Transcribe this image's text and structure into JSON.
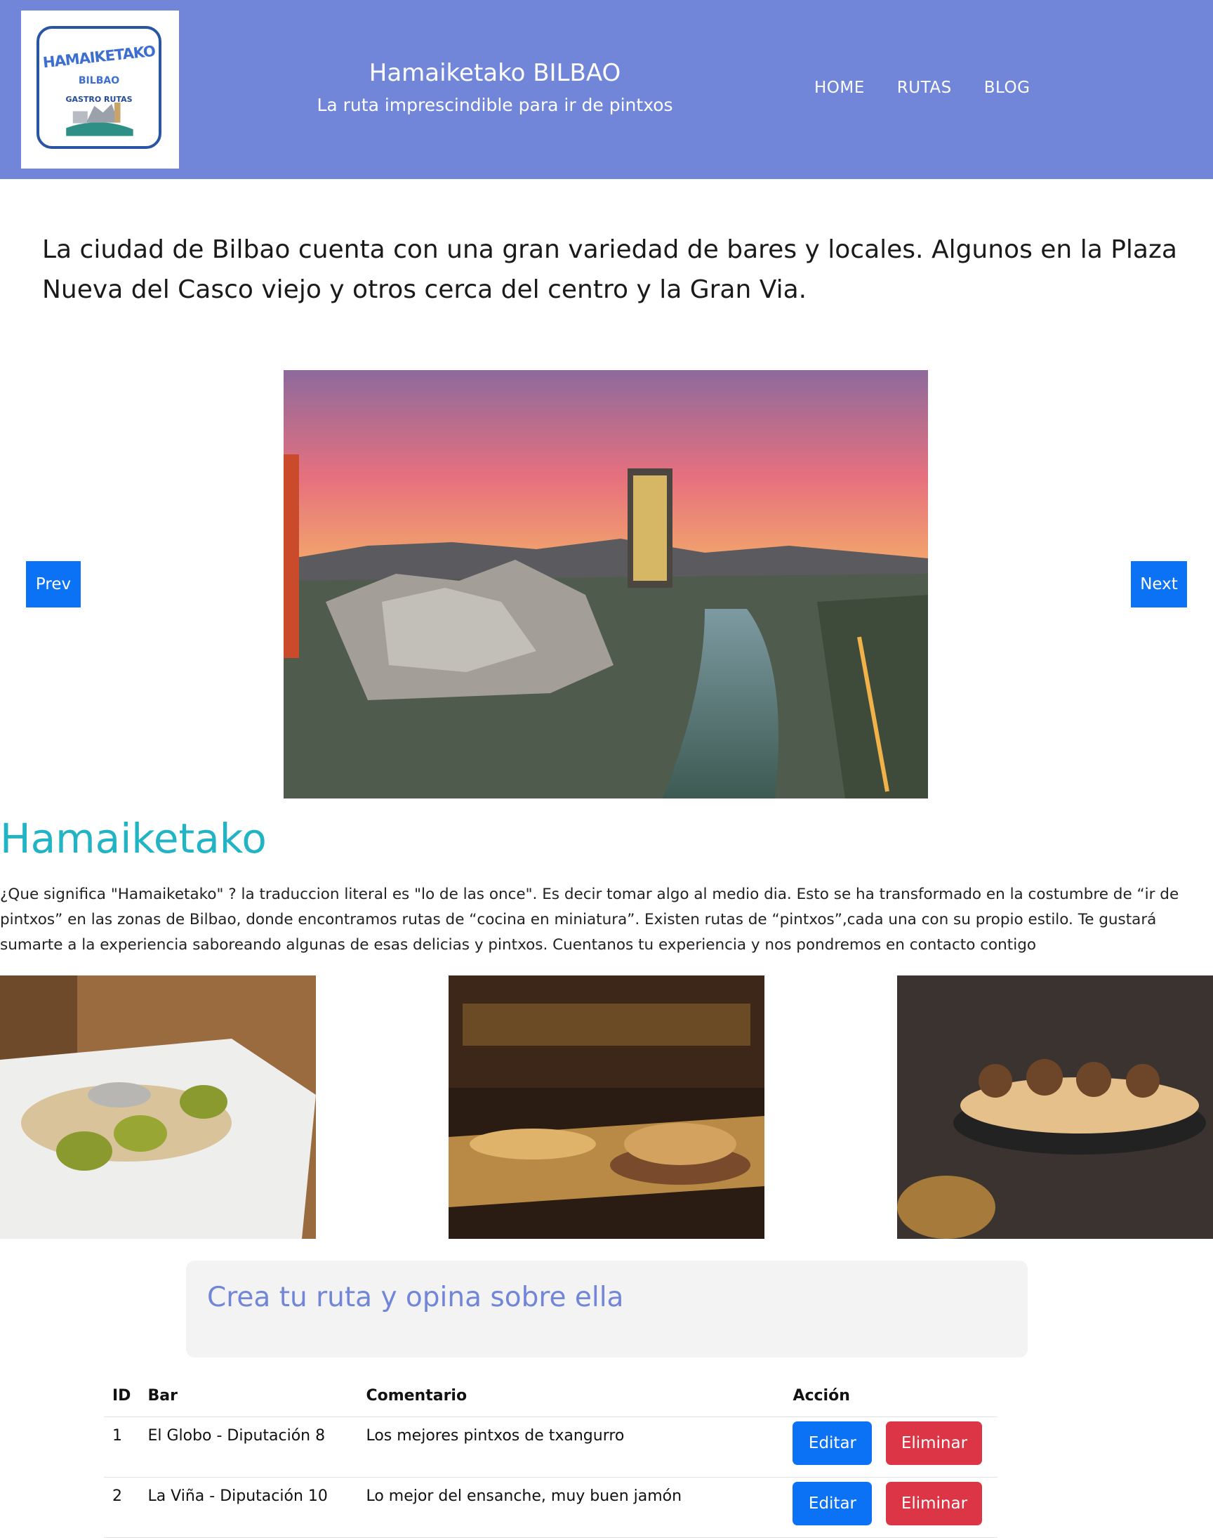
{
  "header": {
    "logo": {
      "line1": "HAMAIKETAKO",
      "line2": "BILBAO",
      "line3": "GASTRO RUTAS"
    },
    "title": "Hamaiketako BILBAO",
    "subtitle": "La ruta imprescindible para ir de pintxos",
    "nav": [
      "HOME",
      "RUTAS",
      "BLOG"
    ]
  },
  "intro": "La ciudad de Bilbao cuenta con una gran variedad de bares y locales. Algunos en la Plaza Nueva del Casco viejo y otros cerca del centro y la Gran Via.",
  "carousel": {
    "prev_label": "Prev",
    "next_label": "Next"
  },
  "section": {
    "heading": "Hamaiketako",
    "text": "¿Que significa \"Hamaiketako\" ? la traduccion literal es \"lo de las once\". Es decir tomar algo al medio dia. Esto se ha transformado en la costumbre de “ir de pintxos” en las zonas de Bilbao, donde encontramos rutas de “cocina en miniatura”. Existen rutas de “pintxos”,cada una con su propio estilo. Te gustará sumarte a la experiencia saboreando algunas de esas delicias y pintxos. Cuentanos tu experiencia y nos pondremos en contacto contigo"
  },
  "route_box": {
    "title": "Crea tu ruta y opina sobre ella"
  },
  "table": {
    "headers": [
      "ID",
      "Bar",
      "Comentario",
      "Acción"
    ],
    "rows": [
      {
        "id": "1",
        "bar": "El Globo - Diputación 8",
        "comment": "Los mejores pintxos de txangurro",
        "edit": "Editar",
        "delete": "Eliminar"
      },
      {
        "id": "2",
        "bar": "La Viña - Diputación 10",
        "comment": "Lo mejor del ensanche, muy buen jamón",
        "edit": "Editar",
        "delete": "Eliminar"
      }
    ]
  },
  "colors": {
    "header_bg": "#7286d9",
    "primary_button": "#0b72f5",
    "danger_button": "#dc3545",
    "heading_teal": "#22b3c4"
  }
}
